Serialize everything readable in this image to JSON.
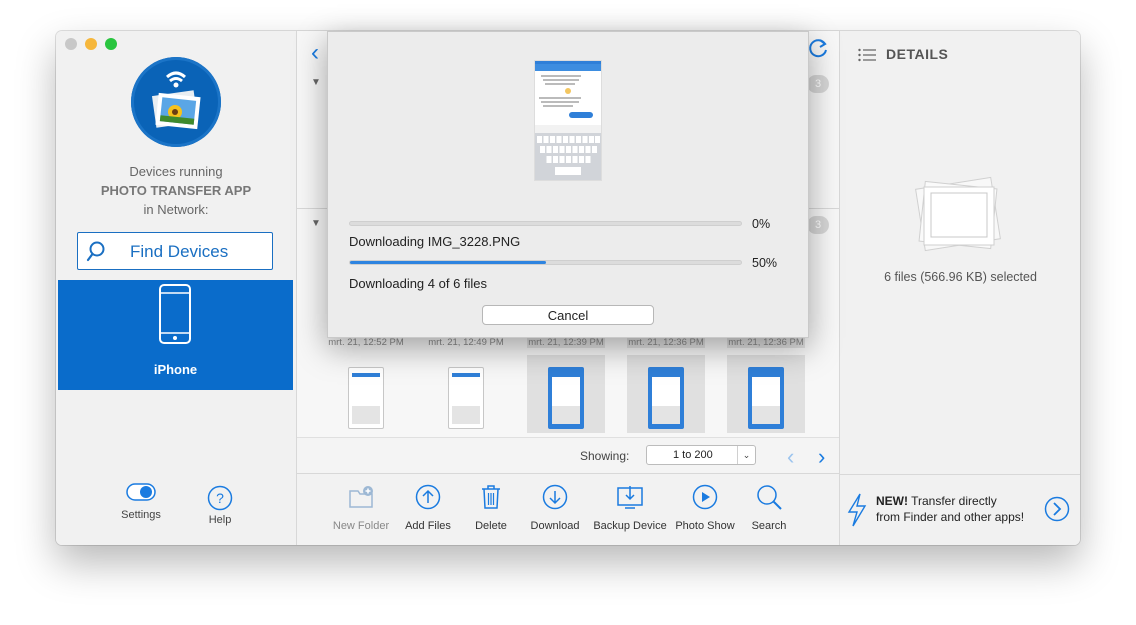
{
  "sidebar": {
    "devices_line1": "Devices running",
    "devices_line2": "PHOTO TRANSFER APP",
    "devices_line3": "in Network:",
    "find_devices_label": "Find Devices",
    "selected_device": "iPhone",
    "settings_label": "Settings",
    "help_label": "Help"
  },
  "main": {
    "thumbnails": [
      {
        "timestamp": "mrt. 21, 12:52 PM",
        "selected": false
      },
      {
        "timestamp": "mrt. 21, 12:49 PM",
        "selected": false
      },
      {
        "timestamp": "mrt. 21, 12:39 PM",
        "selected": true
      },
      {
        "timestamp": "mrt. 21, 12:36 PM",
        "selected": true
      },
      {
        "timestamp": "mrt. 21, 12:36 PM",
        "selected": true
      }
    ],
    "section_badges": [
      "3",
      "3"
    ],
    "showing_label": "Showing:",
    "range_value": "1 to 200"
  },
  "toolbar": {
    "new_folder": "New Folder",
    "add_files": "Add Files",
    "delete": "Delete",
    "download": "Download",
    "backup_device": "Backup Device",
    "photo_show": "Photo Show",
    "search": "Search"
  },
  "details": {
    "header": "DETAILS",
    "selection_text": "6 files (566.96 KB) selected",
    "promo_bold": "NEW!",
    "promo_line1": " Transfer directly",
    "promo_line2": "from Finder and other apps!"
  },
  "dialog": {
    "file_progress_pct": "0%",
    "file_progress_value": 0,
    "file_text": "Downloading IMG_3228.PNG",
    "overall_progress_pct": "50%",
    "overall_progress_value": 50,
    "overall_text": "Downloading 4 of 6 files",
    "cancel_label": "Cancel"
  },
  "colors": {
    "accent": "#0a6ccb",
    "link_blue": "#1a7be0",
    "progress_blue": "#2e84e0"
  }
}
